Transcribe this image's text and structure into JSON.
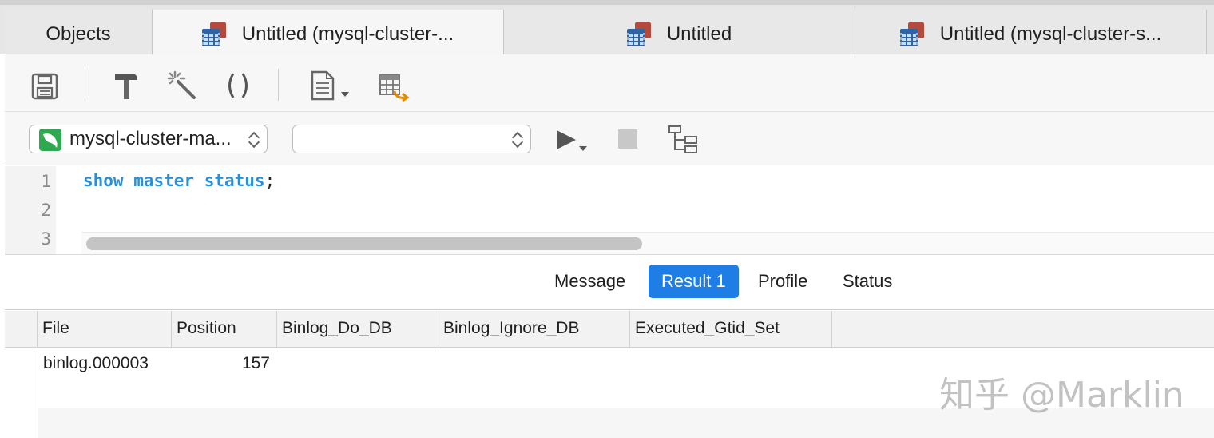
{
  "tabs": [
    {
      "label": "Objects"
    },
    {
      "label": "Untitled (mysql-cluster-..."
    },
    {
      "label": "Untitled"
    },
    {
      "label": "Untitled (mysql-cluster-s..."
    }
  ],
  "toolbar": {
    "icons": [
      "save-icon",
      "hammer-icon",
      "magic-wand-icon",
      "parentheses-icon",
      "document-icon",
      "export-table-icon"
    ]
  },
  "connection": {
    "selected": "mysql-cluster-ma...",
    "database": ""
  },
  "editor": {
    "line_numbers": [
      "1",
      "2",
      "3"
    ],
    "code_keyword": "show master status",
    "code_punct": ";"
  },
  "result_tabs": [
    {
      "label": "Message"
    },
    {
      "label": "Result 1"
    },
    {
      "label": "Profile"
    },
    {
      "label": "Status"
    }
  ],
  "grid": {
    "columns": [
      "File",
      "Position",
      "Binlog_Do_DB",
      "Binlog_Ignore_DB",
      "Executed_Gtid_Set"
    ],
    "rows": [
      {
        "file": "binlog.000003",
        "position": "157",
        "binlog_do_db": "",
        "binlog_ignore_db": "",
        "executed_gtid_set": ""
      }
    ]
  },
  "watermark": "知乎 @Marklin",
  "colors": {
    "accent": "#1f7de6",
    "keyword": "#2a8fd6"
  }
}
